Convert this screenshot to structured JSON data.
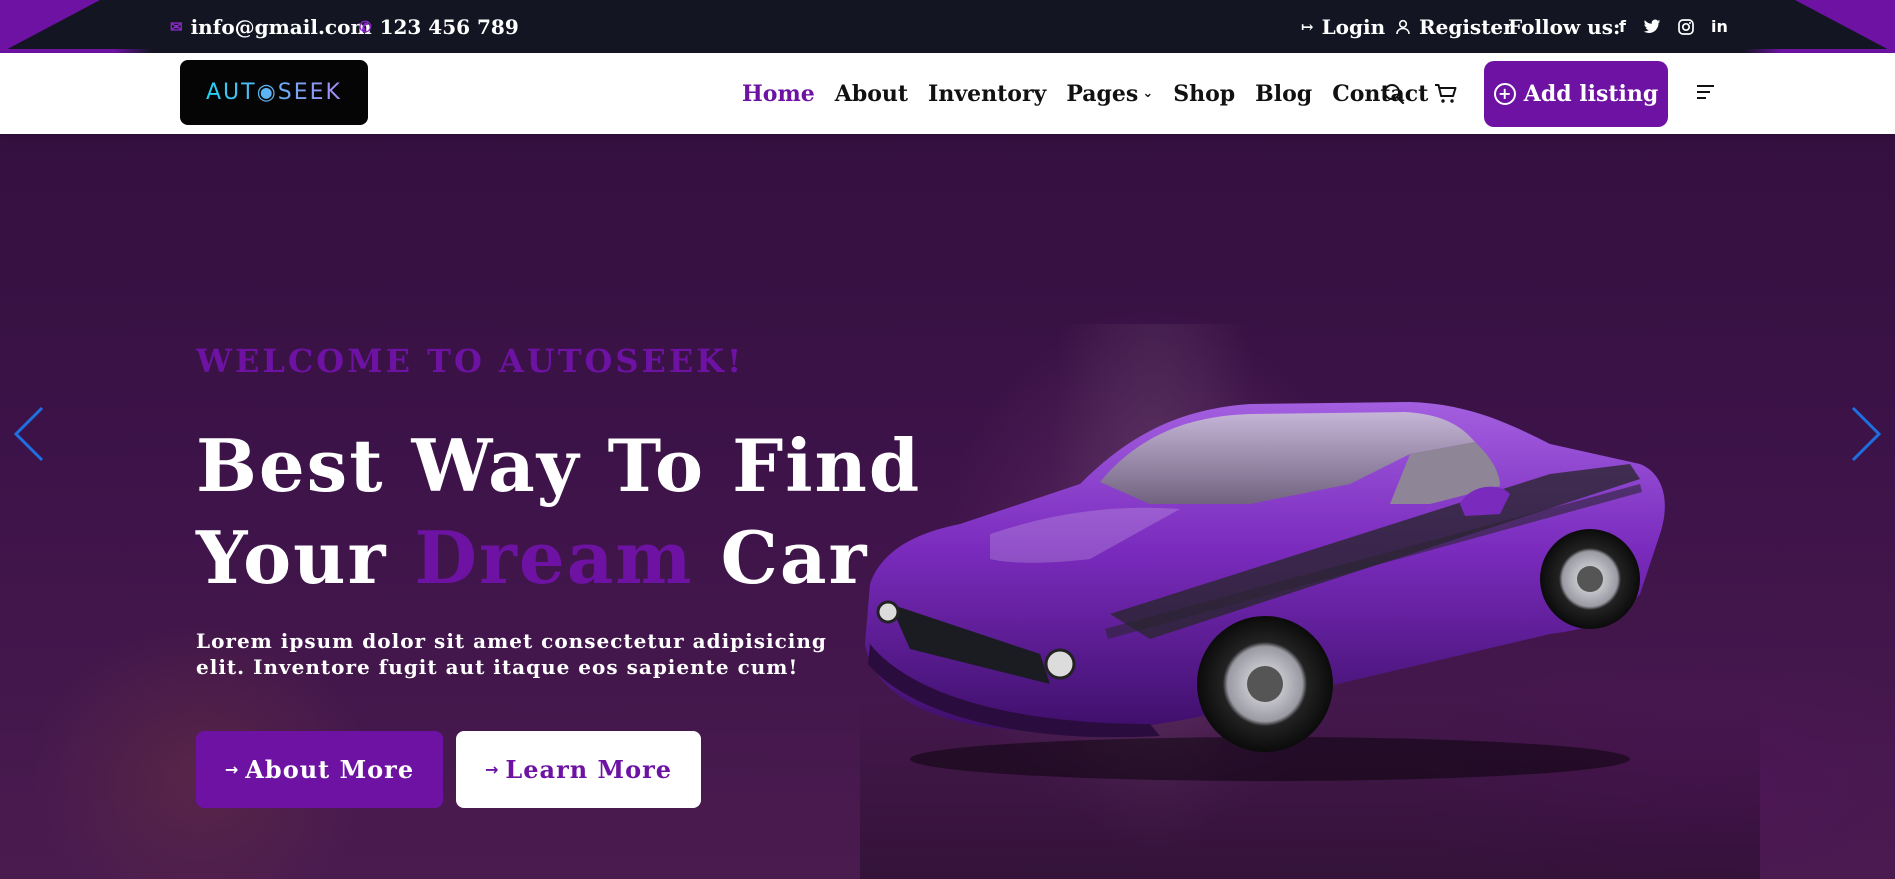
{
  "topbar": {
    "email": "info@gmail.com",
    "phone": "123 456 789",
    "login": "Login",
    "register": "Register",
    "follow_label": "Follow us:",
    "social": [
      "f",
      "twitter",
      "instagram",
      "in"
    ]
  },
  "navbar": {
    "logo": "AUT◉SEEK",
    "links": {
      "home": "Home",
      "about": "About",
      "inventory": "Inventory",
      "pages": "Pages",
      "shop": "Shop",
      "blog": "Blog",
      "contact": "Contact"
    },
    "add_listing": "Add listing",
    "icons": [
      "search-icon",
      "cart-icon",
      "menu-icon"
    ]
  },
  "hero": {
    "welcome": "WELCOME TO AUTOSEEK!",
    "headline_line1": "Best Way To Find",
    "headline_line2_pre": "Your ",
    "headline_line2_highlight": "Dream",
    "headline_line2_post": " Car",
    "subtext": "Lorem ipsum dolor sit amet consectetur adipisicing elit. Inventore fugit aut itaque eos sapiente cum!",
    "primary_button": "About More",
    "secondary_button": "Learn More"
  },
  "colors": {
    "accent": "#6d12a3",
    "topbar_bg": "#131622",
    "hero_bg": "#3a1247",
    "arrow": "#1e6fe0"
  }
}
